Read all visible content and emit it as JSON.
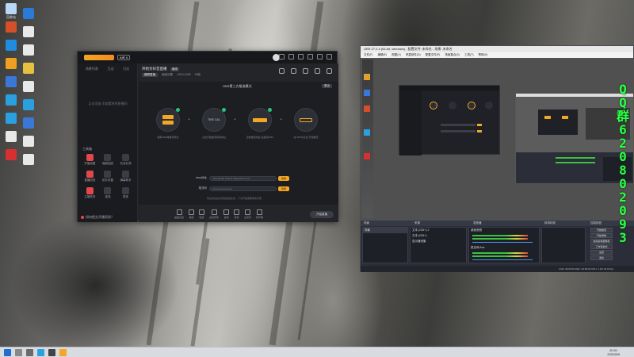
{
  "desktop": {
    "icons": [
      {
        "label": "回收站",
        "color": "#b9d8f5"
      },
      {
        "label": "",
        "color": "#2a7ad8"
      },
      {
        "label": "",
        "color": "#d44f2a"
      },
      {
        "label": "",
        "color": "#e8e8e8"
      },
      {
        "label": "",
        "color": "#1f8ce0"
      },
      {
        "label": "",
        "color": "#e8e8e8"
      },
      {
        "label": "",
        "color": "#f0a020"
      },
      {
        "label": "",
        "color": "#e8c040"
      },
      {
        "label": "",
        "color": "#3a78d8"
      },
      {
        "label": "",
        "color": "#e8e8e8"
      },
      {
        "label": "",
        "color": "#2aa0e0"
      },
      {
        "label": "",
        "color": "#2aa0e0"
      },
      {
        "label": "",
        "color": "#2aa0e0"
      },
      {
        "label": "",
        "color": "#3a78d8"
      },
      {
        "label": "",
        "color": "#e8e8e8"
      },
      {
        "label": "",
        "color": "#e8e8e8"
      },
      {
        "label": "",
        "color": "#d83030"
      },
      {
        "label": "",
        "color": "#e8e8e8"
      }
    ]
  },
  "taskbar": {
    "clock_time": "20:01",
    "clock_date": "2022/8/9"
  },
  "stream_app": {
    "logo_text": "直播伴侣",
    "version": "AIR 4",
    "left_tabs": [
      "场景列表",
      "互动",
      "日志"
    ],
    "empty_hint": "点击添加 添加素材到直播间",
    "tools_title": "工具箱",
    "tools": [
      {
        "label": "开播设置",
        "hot": true
      },
      {
        "label": "福袋抽奖",
        "hot": false
      },
      {
        "label": "红包礼物",
        "hot": false
      },
      {
        "label": "直播回放",
        "hot": true
      },
      {
        "label": "贴片设置",
        "hot": false
      },
      {
        "label": "弹幕助手",
        "hot": false
      },
      {
        "label": "主播任务",
        "hot": true
      },
      {
        "label": "连线",
        "hot": false
      },
      {
        "label": "更多",
        "hot": false
      }
    ],
    "footer_text": "如何提交开播资质？",
    "room_title": "开始为抖音直播",
    "room_badge": "编辑",
    "room_meta": [
      "横屏直播",
      "画面设置",
      "1920×1080",
      "25帧"
    ],
    "panel_title": "OBS第三方推流模式",
    "panel_top_button": "退出",
    "steps": [
      {
        "text": "",
        "caption": "使用OBS等推流软件"
      },
      {
        "text": "TIKE CAL",
        "caption": "点击开始推流获取地址"
      },
      {
        "text": "",
        "caption": "复制推流地址 粘贴到OBS"
      },
      {
        "text": "",
        "caption": "在OBS中点击 开始推流"
      }
    ],
    "fields": [
      {
        "label": "rtmp地址",
        "value": "rtmp://push-rtmp-l1.douyincdn.com/",
        "button": "复制"
      },
      {
        "label": "推流码",
        "value": "••••••••••••••••••••••••",
        "button": "复制"
      }
    ],
    "panel_note": "地址将在您关闭直播后失效，下次开播需要重新获取",
    "bottom_items": [
      "画面设置",
      "美颜",
      "贴纸",
      "虚拟形象",
      "合唱",
      "音效",
      "麦克风",
      "扬声器"
    ],
    "go_live": "开始直播"
  },
  "obs": {
    "title": "OBS 27.2.4 (64-bit, windows) - 配置文件: 未命名 - 场景: 未命名",
    "menu": [
      "文件(F)",
      "编辑(E)",
      "视图(V)",
      "停靠部件(D)",
      "配置文件(P)",
      "场景集合(S)",
      "工具(T)",
      "帮助(H)"
    ],
    "docks": {
      "scenes": "场景",
      "sources": "来源",
      "mixer": "混音器",
      "transitions": "转场特效",
      "controls": "控制按钮"
    },
    "scene_items": [
      "场景"
    ],
    "source_items": [
      "文本 (GDI+) 2",
      "文本 (GDI+)",
      "显示器采集"
    ],
    "mixer_tracks": [
      "桌面音频",
      "麦克风/Aux"
    ],
    "controls": [
      "开始推流",
      "开始录制",
      "启动虚拟摄像机",
      "工作室模式",
      "设置",
      "退出"
    ],
    "status": "LIVE: 00:00:00  REC: 00:00:00  CPU: 1.6%  30.00 fps"
  },
  "overlay": {
    "chars": [
      "Q",
      "Q",
      "群",
      "6",
      "2",
      "0",
      "8",
      "0",
      "2",
      "0",
      "9",
      "3"
    ],
    "color": "#2cff47"
  }
}
